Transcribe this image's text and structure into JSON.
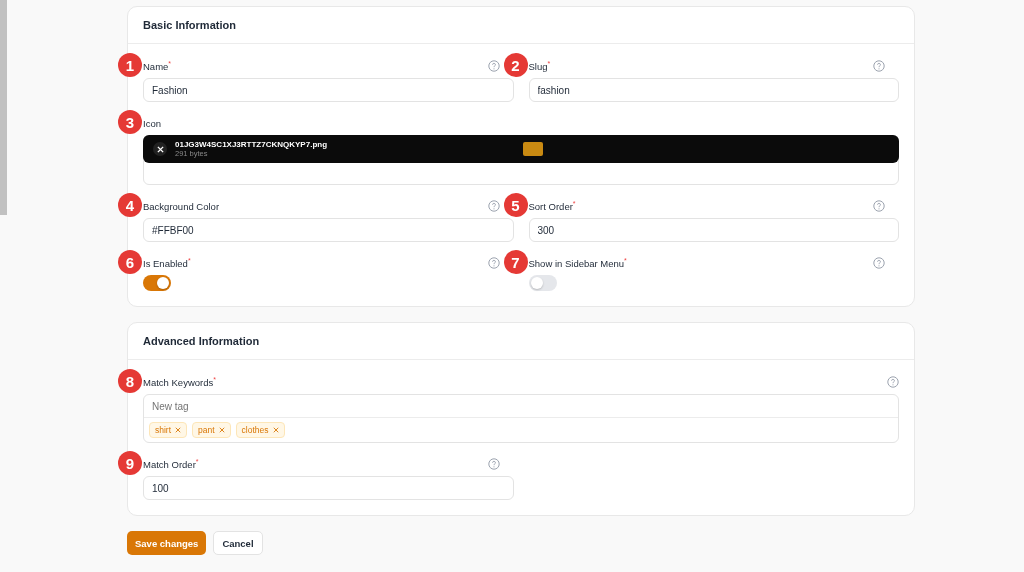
{
  "sections": [
    {
      "title": "Basic Information",
      "fields": [
        {
          "badge": "1",
          "label": "Name",
          "required_mark": "*",
          "help": true,
          "kind": "text",
          "value": "Fashion",
          "wide": false
        },
        {
          "badge": "2",
          "label": "Slug",
          "required_mark": "*",
          "help": true,
          "kind": "text",
          "value": "fashion",
          "wide": false
        },
        {
          "badge": "3",
          "label": "Icon",
          "help": false,
          "kind": "file",
          "file_name": "01JG3W4SC1XJ3RTTZ7CKNQKYP7.png",
          "file_size": "291 bytes",
          "wide": true
        },
        {
          "badge": "4",
          "label": "Background Color",
          "help": true,
          "kind": "text",
          "value": "#FFBF00",
          "wide": false
        },
        {
          "badge": "5",
          "label": "Sort Order",
          "required_mark": "*",
          "help": true,
          "kind": "text",
          "value": "300",
          "wide": false
        },
        {
          "badge": "6",
          "label": "Is Enabled",
          "required_mark": "*",
          "help": true,
          "kind": "toggle",
          "on": true,
          "wide": false
        },
        {
          "badge": "7",
          "label": "Show in Sidebar Menu",
          "required_mark": "*",
          "help": true,
          "kind": "toggle",
          "on": false,
          "wide": false
        }
      ]
    },
    {
      "title": "Advanced Information",
      "fields": [
        {
          "badge": "8",
          "label": "Match Keywords",
          "required_mark": "*",
          "help": true,
          "kind": "tags",
          "placeholder": "New tag",
          "tags": [
            "shirt",
            "pant",
            "clothes"
          ],
          "wide": true
        },
        {
          "badge": "9",
          "label": "Match Order",
          "required_mark": "*",
          "help": true,
          "kind": "text",
          "value": "100",
          "wide": false
        }
      ]
    }
  ],
  "buttons": [
    {
      "label": "Save changes",
      "kind": "primary"
    },
    {
      "label": "Cancel",
      "kind": "secondary"
    }
  ]
}
